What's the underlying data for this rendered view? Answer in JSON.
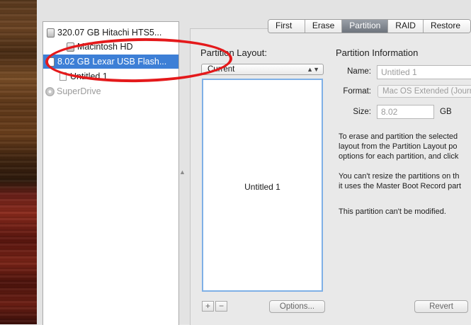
{
  "sidebar": {
    "items": [
      {
        "label": "320.07 GB Hitachi HTS5...",
        "kind": "disk"
      },
      {
        "label": "Macintosh HD",
        "kind": "volume"
      },
      {
        "label": "8.02 GB Lexar USB Flash...",
        "kind": "disk",
        "selected": true
      },
      {
        "label": "Untitled 1",
        "kind": "volume"
      },
      {
        "label": "SuperDrive",
        "kind": "optical"
      }
    ]
  },
  "tabs": [
    "First Aid",
    "Erase",
    "Partition",
    "RAID",
    "Restore"
  ],
  "active_tab": "Partition",
  "partition_layout": {
    "heading": "Partition Layout:",
    "selected": "Current",
    "partition_name": "Untitled 1",
    "add_label": "+",
    "remove_label": "−",
    "options_label": "Options..."
  },
  "partition_info": {
    "heading": "Partition Information",
    "name_label": "Name:",
    "name_value": "Untitled 1",
    "format_label": "Format:",
    "format_value": "Mac OS Extended (Journ",
    "size_label": "Size:",
    "size_value": "8.02",
    "size_unit": "GB",
    "text1": [
      "To erase and partition the selected",
      "layout from the Partition Layout po",
      "options for each partition, and click"
    ],
    "text2": [
      "You can't resize the partitions on th",
      "it uses the Master Boot Record part"
    ],
    "text3": "This partition can't be modified.",
    "revert_label": "Revert"
  },
  "annotation_color": "#e4191b",
  "selection_color": "#3d7fd6"
}
